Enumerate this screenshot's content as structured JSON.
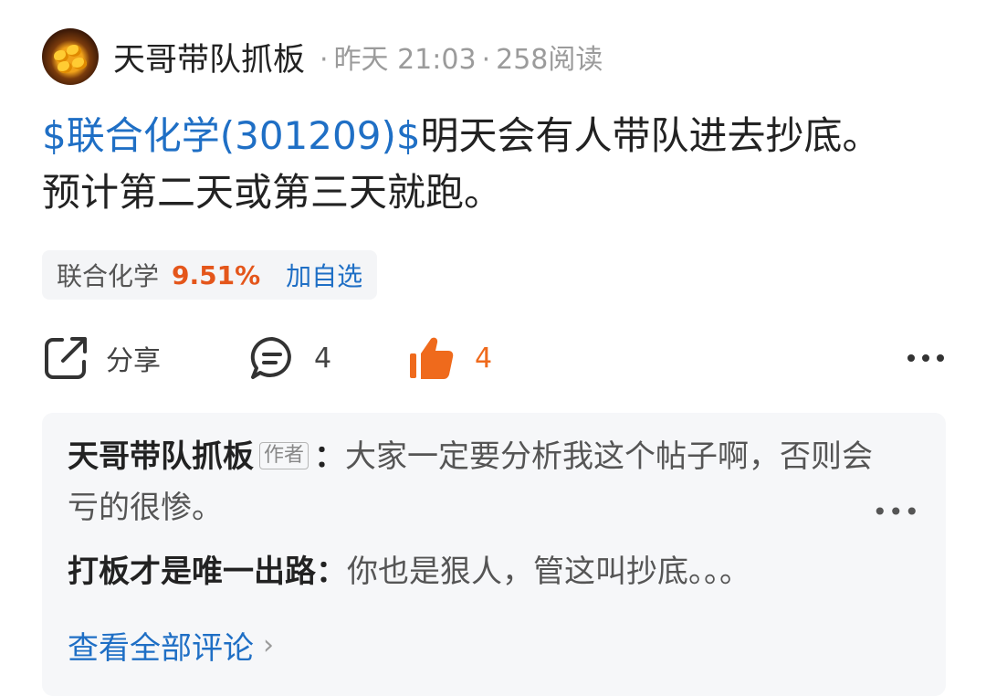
{
  "post": {
    "author": "天哥带队抓板",
    "time": "昨天 21:03",
    "reads": "258阅读",
    "separator": "·",
    "stock_link": "$联合化学(301209)$",
    "body": "明天会有人带队进去抄底。预计第二天或第三天就跑。"
  },
  "stock_chip": {
    "name": "联合化学",
    "change": "9.51%",
    "add_label": "加自选"
  },
  "actions": {
    "share_label": "分享",
    "comment_count": "4",
    "like_count": "4"
  },
  "comments": [
    {
      "name": "天哥带队抓板",
      "badge": "作者",
      "colon": "：",
      "text": "大家一定要分析我这个帖子啊，否则会亏的很惨。"
    },
    {
      "name": "打板才是唯一出路",
      "colon": "：",
      "text": "你也是狠人，管这叫抄底。。。"
    }
  ],
  "view_all_label": "查看全部评论",
  "colors": {
    "link_blue": "#1f6fc5",
    "up_orange": "#e4561b",
    "like_orange": "#ef6a1c"
  }
}
